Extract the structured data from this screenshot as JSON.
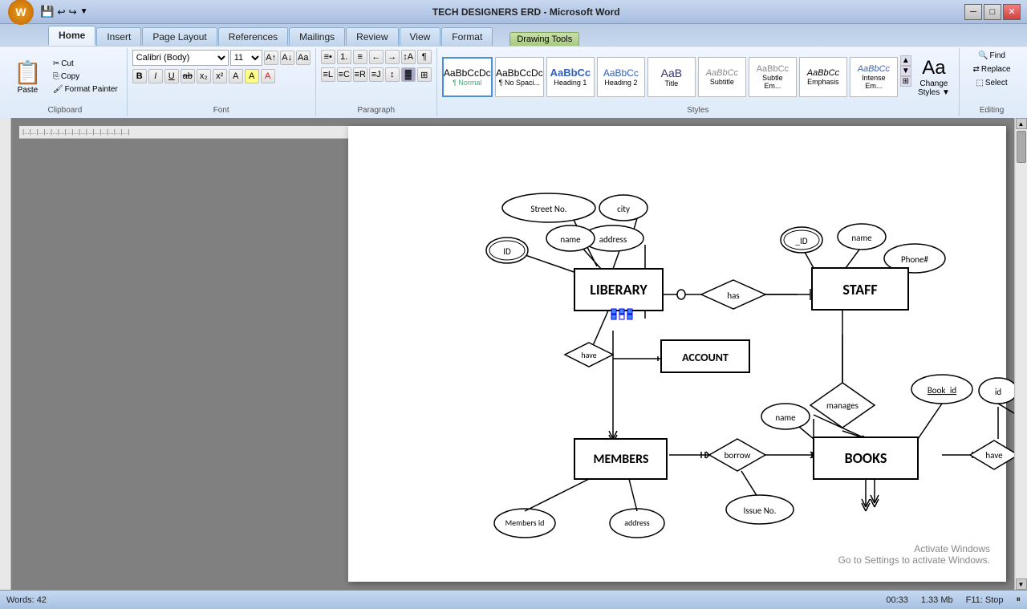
{
  "titlebar": {
    "title": "TECH DESIGNERS ERD - Microsoft Word",
    "drawing_tools_tab": "Drawing Tools",
    "min_label": "─",
    "max_label": "□",
    "close_label": "✕"
  },
  "tabs": [
    {
      "label": "Home",
      "active": true
    },
    {
      "label": "Insert",
      "active": false
    },
    {
      "label": "Page Layout",
      "active": false
    },
    {
      "label": "References",
      "active": false
    },
    {
      "label": "Mailings",
      "active": false
    },
    {
      "label": "Review",
      "active": false
    },
    {
      "label": "View",
      "active": false
    },
    {
      "label": "Format",
      "active": false
    }
  ],
  "drawing_tools_tab": "Drawing Tools",
  "ribbon": {
    "clipboard_group": "Clipboard",
    "paste_label": "Paste",
    "cut_label": "Cut",
    "copy_label": "Copy",
    "format_painter_label": "Format Painter",
    "font_group": "Font",
    "font_name": "Calibri (Body)",
    "font_size": "11",
    "paragraph_group": "Paragraph",
    "styles_group": "Styles",
    "style_normal": "Normal",
    "style_no_spacing": "No Spaci...",
    "style_heading1": "Heading 1",
    "style_heading2": "Heading 2",
    "style_title": "Title",
    "style_subtitle": "Subtitle",
    "style_subtle_em": "Subtle Em...",
    "style_emphasis": "Emphasis",
    "style_intense_em": "Intense Em...",
    "change_styles_label": "Change\nStyles",
    "find_label": "Find",
    "replace_label": "Replace",
    "select_label": "Select",
    "editing_label": "Editing"
  },
  "statusbar": {
    "words_label": "Words: 42",
    "time_label": "00:33",
    "file_size": "1.33 Mb",
    "f11_label": "F11: Stop"
  },
  "diagram": {
    "activate_line1": "Activate Windows",
    "activate_line2": "Go to Settings to activate Windows."
  }
}
